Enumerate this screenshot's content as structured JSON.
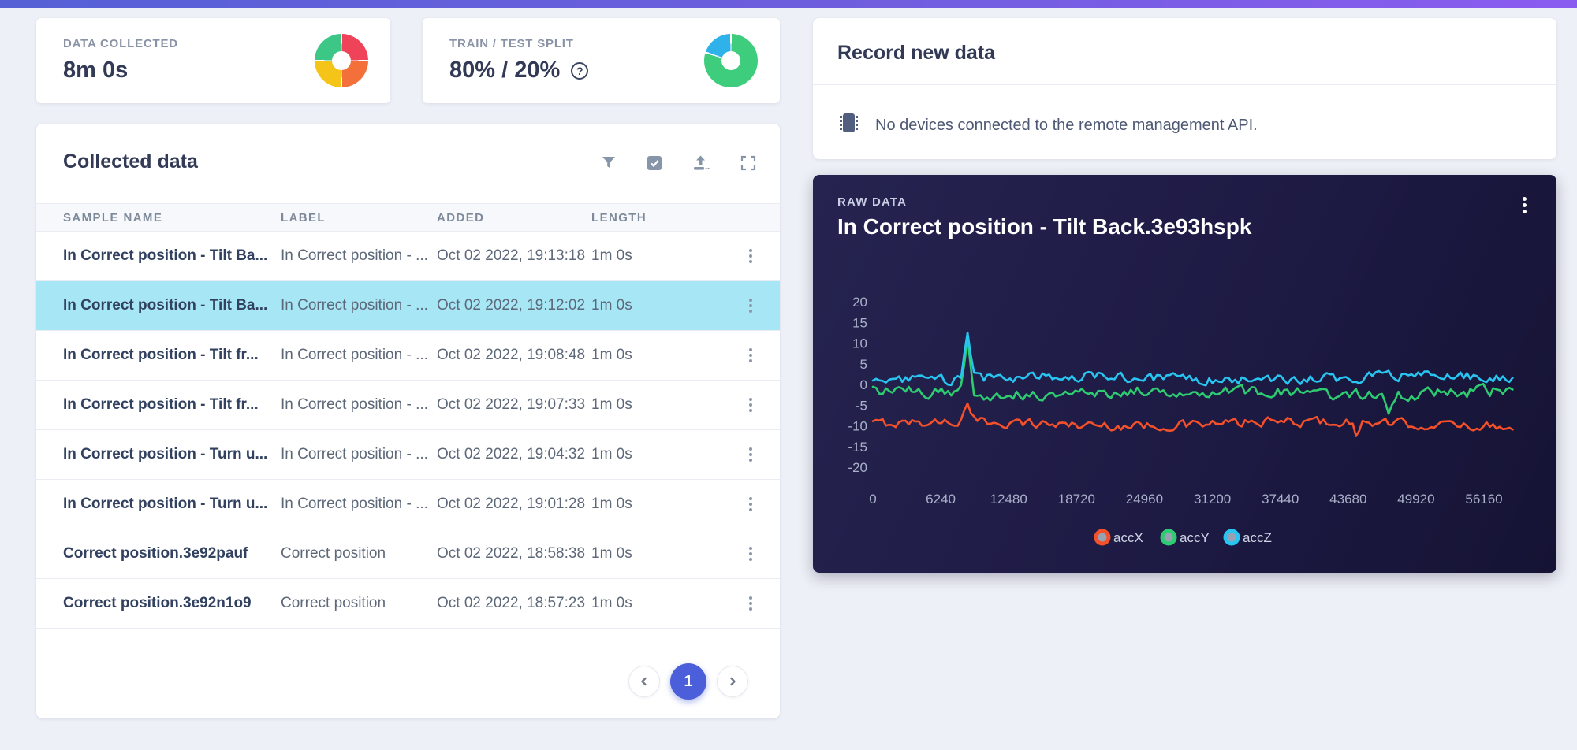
{
  "page": {
    "background": "#eef0f7",
    "topbar_gradient": [
      "#5661d6",
      "#8b5cf0"
    ]
  },
  "stats": {
    "data_collected": {
      "label": "DATA COLLECTED",
      "value": "8m 0s",
      "pie_colors": {
        "red": "#ee4358",
        "orange": "#f4703a",
        "yellow": "#f5c418",
        "green": "#3dc787"
      }
    },
    "train_test_split": {
      "label": "TRAIN / TEST SPLIT",
      "value": "80% / 20%",
      "help_glyph": "?",
      "donut": {
        "train_pct": 80,
        "test_pct": 20,
        "train_color": "#3ecc7d",
        "test_color": "#2fb1ea"
      }
    }
  },
  "collected_data": {
    "title": "Collected data",
    "toolbar_icons": [
      "filter-icon",
      "select-all-icon",
      "upload-icon",
      "expand-icon"
    ],
    "columns": [
      "SAMPLE NAME",
      "LABEL",
      "ADDED",
      "LENGTH"
    ],
    "selected_row_color": "#a7e6f5",
    "rows": [
      {
        "sample_name": "In Correct position - Tilt Ba...",
        "label": "In Correct position - ...",
        "added": "Oct 02 2022, 19:13:18",
        "length": "1m 0s",
        "selected": false
      },
      {
        "sample_name": "In Correct position - Tilt Ba...",
        "label": "In Correct position - ...",
        "added": "Oct 02 2022, 19:12:02",
        "length": "1m 0s",
        "selected": true
      },
      {
        "sample_name": "In Correct position - Tilt fr...",
        "label": "In Correct position - ...",
        "added": "Oct 02 2022, 19:08:48",
        "length": "1m 0s",
        "selected": false
      },
      {
        "sample_name": "In Correct position - Tilt fr...",
        "label": "In Correct position - ...",
        "added": "Oct 02 2022, 19:07:33",
        "length": "1m 0s",
        "selected": false
      },
      {
        "sample_name": "In Correct position - Turn u...",
        "label": "In Correct position - ...",
        "added": "Oct 02 2022, 19:04:32",
        "length": "1m 0s",
        "selected": false
      },
      {
        "sample_name": "In Correct position - Turn u...",
        "label": "In Correct position - ...",
        "added": "Oct 02 2022, 19:01:28",
        "length": "1m 0s",
        "selected": false
      },
      {
        "sample_name": "Correct position.3e92pauf",
        "label": "Correct position",
        "added": "Oct 02 2022, 18:58:38",
        "length": "1m 0s",
        "selected": false
      },
      {
        "sample_name": "Correct position.3e92n1o9",
        "label": "Correct position",
        "added": "Oct 02 2022, 18:57:23",
        "length": "1m 0s",
        "selected": false
      }
    ],
    "pagination": {
      "current_page": "1"
    }
  },
  "record_new_data": {
    "title": "Record new data",
    "device_icon": "microchip-icon",
    "device_status": "No devices connected to the remote management API."
  },
  "raw_data": {
    "eyebrow": "RAW DATA",
    "title": "In Correct position - Tilt Back.3e93hspk",
    "menu_icon": "kebab-menu-icon"
  },
  "chart_data": {
    "type": "line",
    "title": "In Correct position - Tilt Back.3e93hspk",
    "xlabel": "",
    "ylabel": "",
    "x_ticks": [
      0,
      6240,
      12480,
      18720,
      24960,
      31200,
      37440,
      43680,
      49920,
      56160
    ],
    "xlim": [
      0,
      59000
    ],
    "y_ticks": [
      20,
      15,
      10,
      5,
      0,
      -5,
      -10,
      -15,
      -20
    ],
    "ylim": [
      -22,
      22
    ],
    "grid": false,
    "legend_position": "bottom",
    "tick_color": "#a9b0c8",
    "legend_text_color": "#ced3e4",
    "series": [
      {
        "name": "accX",
        "color": "#f4502a",
        "baseline_mean": -9.5,
        "noise_amplitude": 1.3,
        "spikes": [
          {
            "x": 8700,
            "value": -5.8
          },
          {
            "x": 44500,
            "value": -12.3
          }
        ]
      },
      {
        "name": "accY",
        "color": "#2ecc71",
        "baseline_mean": -2.0,
        "noise_amplitude": 1.6,
        "spikes": [
          {
            "x": 8700,
            "value": 11.5
          },
          {
            "x": 47500,
            "value": -6.5
          }
        ]
      },
      {
        "name": "accZ",
        "color": "#28c5f1",
        "baseline_mean": 1.5,
        "noise_amplitude": 1.4,
        "spikes": [
          {
            "x": 8700,
            "value": 11.8
          }
        ]
      }
    ]
  }
}
